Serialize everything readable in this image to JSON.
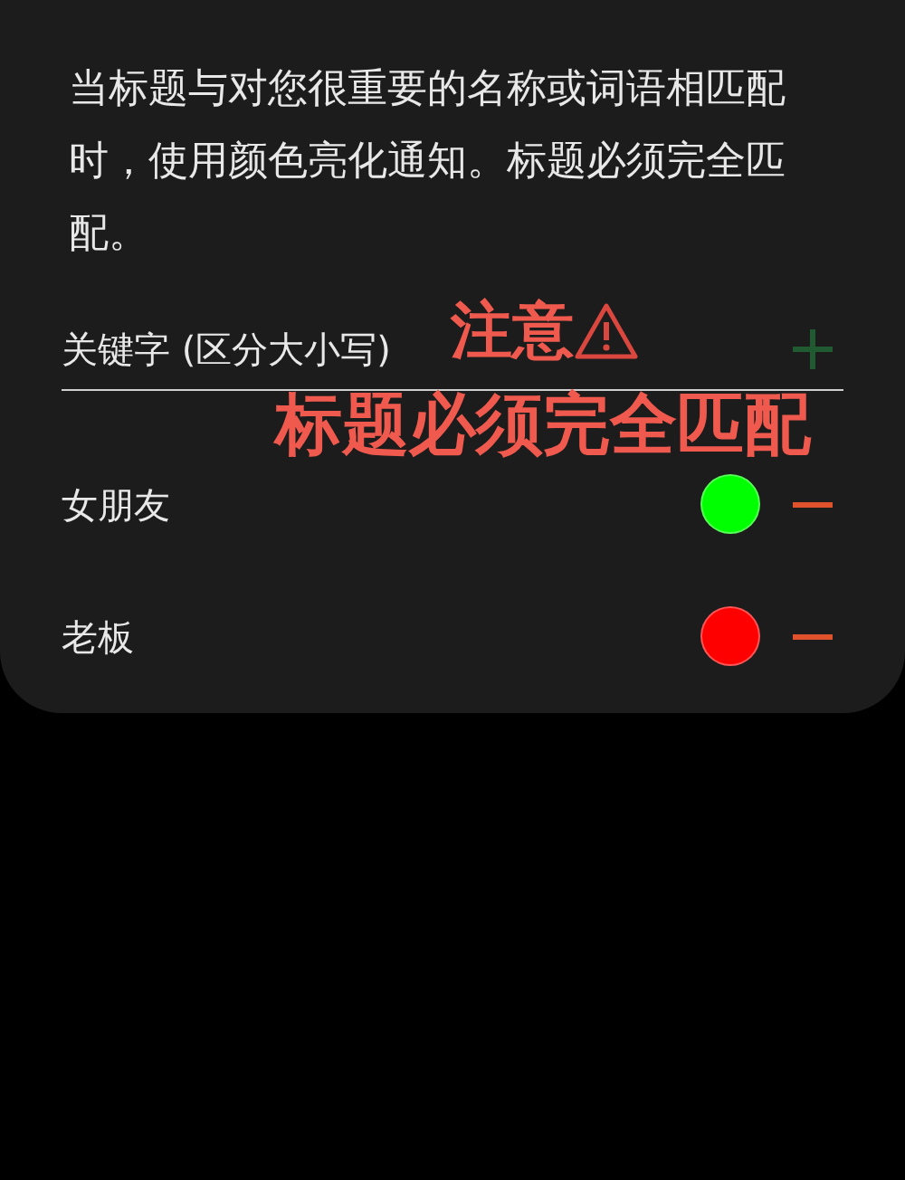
{
  "description": "当标题与对您很重要的名称或词语相匹配时，使用颜色亮化通知。标题必须完全匹配。",
  "keyword_field": {
    "placeholder": "关键字 (区分大小写)",
    "add_disabled": true
  },
  "keywords": [
    {
      "name": "女朋友",
      "color": "#00ff00"
    },
    {
      "name": "老板",
      "color": "#ff0000"
    }
  ],
  "annotation": {
    "line_1": "注意",
    "line_2": "标题必须完全匹配"
  }
}
